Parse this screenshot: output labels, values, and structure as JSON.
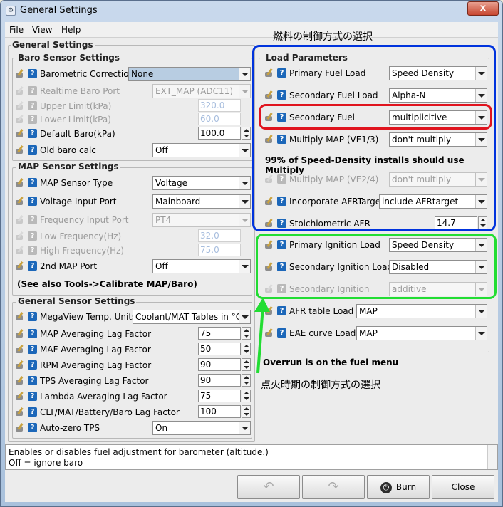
{
  "window": {
    "title": "General Settings",
    "close": "x"
  },
  "menu": {
    "file": "File",
    "view": "View",
    "help": "Help"
  },
  "left": {
    "group_title": "General Settings",
    "baro": {
      "title": "Baro Sensor Settings",
      "barometric_correction": {
        "label": "Barometric Correction",
        "value": "None"
      },
      "realtime_baro_port": {
        "label": "Realtime Baro Port",
        "value": "EXT_MAP (ADC11)"
      },
      "upper_limit": {
        "label": "Upper Limit(kPa)",
        "value": "320.0"
      },
      "lower_limit": {
        "label": "Lower Limit(kPa)",
        "value": "60.0"
      },
      "default_baro": {
        "label": "Default Baro(kPa)",
        "value": "100.0"
      },
      "old_baro": {
        "label": "Old baro calc",
        "value": "Off"
      }
    },
    "map": {
      "title": "MAP Sensor Settings",
      "sensor_type": {
        "label": "MAP Sensor Type",
        "value": "Voltage"
      },
      "voltage_port": {
        "label": "Voltage Input Port",
        "value": "Mainboard"
      },
      "freq_port": {
        "label": "Frequency Input Port",
        "value": "PT4"
      },
      "low_freq": {
        "label": "Low Frequency(Hz)",
        "value": "32.0"
      },
      "high_freq": {
        "label": "High Frequency(Hz)",
        "value": "75.0"
      },
      "second_map": {
        "label": "2nd MAP Port",
        "value": "Off"
      },
      "note": "(See also Tools->Calibrate MAP/Baro)"
    },
    "general": {
      "title": "General Sensor Settings",
      "megaview": {
        "label": "MegaView Temp. Units",
        "value": "Coolant/MAT Tables in °C"
      },
      "map_lag": {
        "label": "MAP Averaging Lag Factor",
        "value": "75"
      },
      "maf_lag": {
        "label": "MAF Averaging Lag Factor",
        "value": "50"
      },
      "rpm_lag": {
        "label": "RPM Averaging Lag Factor",
        "value": "90"
      },
      "tps_lag": {
        "label": "TPS Averaging Lag Factor",
        "value": "90"
      },
      "lambda_lag": {
        "label": "Lambda Averaging Lag Factor",
        "value": "75"
      },
      "clt_lag": {
        "label": "CLT/MAT/Battery/Baro Lag Factor",
        "value": "100"
      },
      "autozero": {
        "label": "Auto-zero TPS",
        "value": "On"
      }
    }
  },
  "right": {
    "title": "Load Parameters",
    "primary_fuel_load": {
      "label": "Primary Fuel Load",
      "value": "Speed Density"
    },
    "secondary_fuel_load": {
      "label": "Secondary Fuel Load",
      "value": "Alpha-N"
    },
    "secondary_fuel": {
      "label": "Secondary Fuel",
      "value": "multiplicitive"
    },
    "multiply_map1": {
      "label": "Multiply MAP (VE1/3)",
      "value": "don't multiply"
    },
    "note1": "99% of Speed-Density installs should use Multiply",
    "multiply_map2": {
      "label": "Multiply MAP (VE2/4)",
      "value": "don't multiply"
    },
    "afr_target": {
      "label": "Incorporate AFRTarget",
      "value": "include AFRtarget"
    },
    "stoich": {
      "label": "Stoichiometric AFR",
      "value": "14.7"
    },
    "primary_ign": {
      "label": "Primary Ignition Load",
      "value": "Speed Density"
    },
    "secondary_ign_load": {
      "label": "Secondary Ignition Load",
      "value": "Disabled"
    },
    "secondary_ign": {
      "label": "Secondary Ignition",
      "value": "additive"
    },
    "afr_table": {
      "label": "AFR table Load",
      "value": "MAP"
    },
    "eae_curve": {
      "label": "EAE curve Load",
      "value": "MAP"
    },
    "note2": "Overrun is on the fuel menu"
  },
  "description": {
    "line1": "Enables or disables fuel adjustment for barometer (altitude.)",
    "line2": "Off = ignore baro"
  },
  "buttons": {
    "burn": "Burn",
    "close": "Close"
  },
  "annotations": {
    "fuel": "燃料の制御方式の選択",
    "ignition": "点火時期の制御方式の選択",
    "blue": "#0033dd",
    "red": "#e0141e",
    "green": "#22dd33"
  }
}
